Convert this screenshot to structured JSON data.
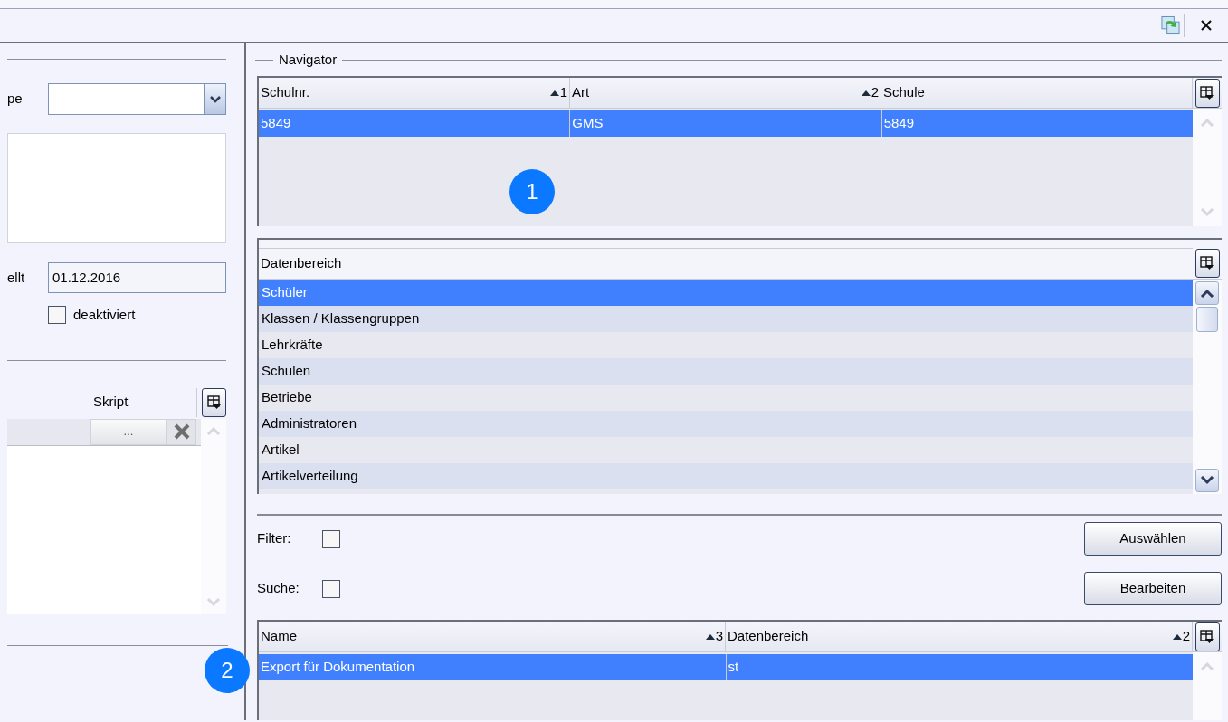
{
  "left_panel": {
    "type_label": "pe",
    "created_label": "ellt",
    "created_value": "01.12.2016",
    "deactivated": {
      "label": "deaktiviert",
      "checked": false
    },
    "script_grid": {
      "column": "Skript",
      "button": "..."
    }
  },
  "navigator": {
    "title": "Navigator",
    "schools": {
      "columns": [
        {
          "label": "Schulnr.",
          "sort": "1"
        },
        {
          "label": "Art",
          "sort": "2"
        },
        {
          "label": "Schule"
        }
      ],
      "rows": [
        {
          "cells": [
            "5849",
            "GMS",
            "5849"
          ],
          "selected": true
        }
      ]
    },
    "data_areas": {
      "column": "Datenbereich",
      "rows": [
        {
          "label": "Schüler",
          "selected": true
        },
        {
          "label": "Klassen / Klassengruppen",
          "selected": false
        },
        {
          "label": "Lehrkräfte",
          "selected": false
        },
        {
          "label": "Schulen",
          "selected": false
        },
        {
          "label": "Betriebe",
          "selected": false
        },
        {
          "label": "Administratoren",
          "selected": false
        },
        {
          "label": "Artikel",
          "selected": false
        },
        {
          "label": "Artikelverteilung",
          "selected": false
        }
      ]
    },
    "filter": {
      "label": "Filter:",
      "checked": false
    },
    "search": {
      "label": "Suche:",
      "checked": false
    },
    "buttons": [
      "Auswählen",
      "Bearbeiten"
    ],
    "exports": {
      "columns": [
        {
          "label": "Name",
          "sort": "3"
        },
        {
          "label": "Datenbereich",
          "sort": "2"
        }
      ],
      "rows": [
        {
          "cells": [
            "Export für Dokumentation",
            "st"
          ],
          "selected": true
        }
      ]
    }
  },
  "callouts": [
    "1",
    "2"
  ]
}
